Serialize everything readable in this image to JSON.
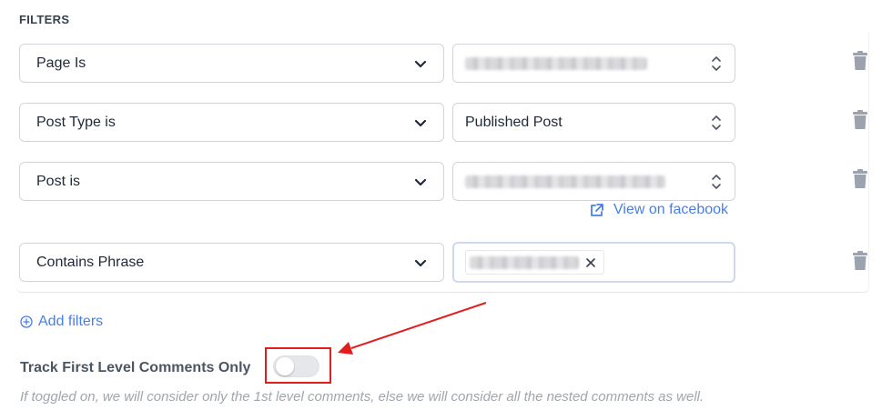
{
  "section": {
    "title": "FILTERS"
  },
  "filters": [
    {
      "condition": "Page Is",
      "value": ""
    },
    {
      "condition": "Post Type is",
      "value": "Published Post"
    },
    {
      "condition": "Post is",
      "value": ""
    },
    {
      "condition": "Contains Phrase",
      "value": ""
    }
  ],
  "view_link": {
    "label": "View on facebook"
  },
  "add_filters": {
    "label": "Add filters"
  },
  "track": {
    "label": "Track First Level Comments Only",
    "enabled": false,
    "hint": "If toggled on, we will consider only the 1st level comments, else we will consider all the nested comments as well."
  },
  "colors": {
    "link": "#4a7ee6",
    "annotation": "#e11d1d"
  },
  "icons": [
    "chevron-down-icon",
    "up-down-icon",
    "trash-icon",
    "external-link-icon",
    "plus-circle-icon",
    "close-icon"
  ]
}
